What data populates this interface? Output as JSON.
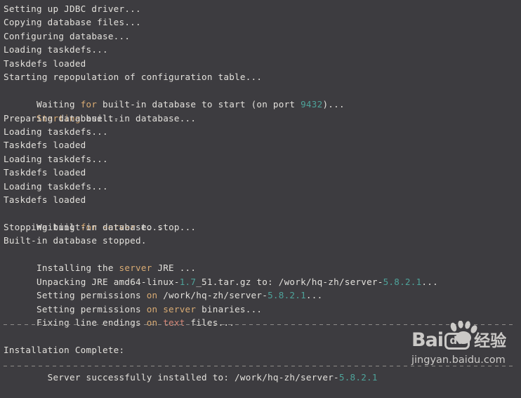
{
  "terminal": {
    "background_color": "#3d3c40",
    "default_text_color": "#e3e1dc",
    "keyword_color": "#d9ab73",
    "number_color": "#4ea39a",
    "string_color": "#d98a7a",
    "lines": [
      {
        "id": "l1",
        "text": "Setting up JDBC driver..."
      },
      {
        "id": "l2",
        "text": "Copying database files..."
      },
      {
        "id": "l3",
        "text": "Configuring database..."
      },
      {
        "id": "l4",
        "text": "Loading taskdefs..."
      },
      {
        "id": "l5",
        "text": "Taskdefs loaded"
      },
      {
        "id": "l6",
        "text": "Starting repopulation of configuration table..."
      },
      {
        "id": "l7",
        "text": "Waiting for built-in database to start (on port 9432)..."
      },
      {
        "id": "l8",
        "text": "Starting built-in database..."
      },
      {
        "id": "l9",
        "text": "Preparing database..."
      },
      {
        "id": "l10",
        "text": "Loading taskdefs..."
      },
      {
        "id": "l11",
        "text": "Taskdefs loaded"
      },
      {
        "id": "l12",
        "text": "Loading taskdefs..."
      },
      {
        "id": "l13",
        "text": "Taskdefs loaded"
      },
      {
        "id": "l14",
        "text": "Loading taskdefs..."
      },
      {
        "id": "l15",
        "text": "Taskdefs loaded"
      },
      {
        "id": "l16",
        "text": "Waiting for server to stop..."
      },
      {
        "id": "l17",
        "text": "Stopping built-in database..."
      },
      {
        "id": "l18",
        "text": "Built-in database stopped."
      },
      {
        "id": "l19",
        "text": "Installing the server JRE ..."
      },
      {
        "id": "l20",
        "text": "Unpacking JRE amd64-linux-1.7_51.tar.gz to: /work/hq-zh/server-5.8.2.1..."
      },
      {
        "id": "l21",
        "text": "Setting permissions on /work/hq-zh/server-5.8.2.1..."
      },
      {
        "id": "l22",
        "text": "Setting permissions on server binaries..."
      },
      {
        "id": "l23",
        "text": "Fixing line endings on text files..."
      },
      {
        "id": "l24",
        "text": ""
      },
      {
        "id": "l25",
        "text": ""
      },
      {
        "id": "l26",
        "text": "Installation Complete:"
      },
      {
        "id": "l27",
        "text": "  Server successfully installed to: /work/hq-zh/server-5.8.2.1"
      }
    ],
    "separators": {
      "top_rule": "----------------------------------------------------------------------",
      "bottom_rule": "----------------------------------------------------------------------"
    },
    "highlighted_tokens": {
      "port_number": "9432",
      "jre_version": "1.7",
      "server_version": "5.8.2.1",
      "text_keyword": "text",
      "for_keyword": "for",
      "on_keyword": "on",
      "server_keyword": "server"
    }
  },
  "watermark": {
    "brand": "Bai",
    "brand_boxed": "du",
    "brand_cn": "经验",
    "url": "jingyan.baidu.com"
  }
}
